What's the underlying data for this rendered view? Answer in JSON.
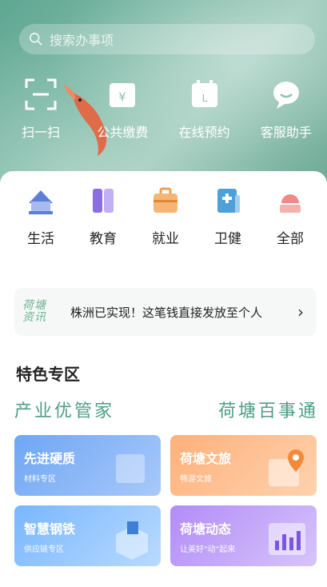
{
  "search": {
    "placeholder": "搜索办事项"
  },
  "quick_actions": [
    {
      "label": "扫一扫",
      "icon": "scan-icon"
    },
    {
      "label": "公共缴费",
      "icon": "payment-icon"
    },
    {
      "label": "在线预约",
      "icon": "calendar-icon"
    },
    {
      "label": "客服助手",
      "icon": "chat-icon"
    }
  ],
  "categories": [
    {
      "label": "生活",
      "icon": "home-icon",
      "color": "#5f7fd6"
    },
    {
      "label": "教育",
      "icon": "book-icon",
      "color": "#8b6fe0"
    },
    {
      "label": "就业",
      "icon": "briefcase-icon",
      "color": "#f2a04e"
    },
    {
      "label": "卫健",
      "icon": "health-icon",
      "color": "#4ea0d8"
    },
    {
      "label": "全部",
      "icon": "all-icon",
      "color": "#f08a86"
    }
  ],
  "news": {
    "tag_line1": "荷塘",
    "tag_line2": "资讯",
    "headline": "株洲已实现！这笔钱直接发放至个人",
    "arrow": "›"
  },
  "featured": {
    "title": "特色专区",
    "tabs": [
      "产业优管家",
      "荷塘百事通"
    ],
    "cards": [
      {
        "title": "先进硬质",
        "subtitle": "材料专区",
        "color": "#6fa6f4"
      },
      {
        "title": "荷塘文旅",
        "subtitle": "畅游文旅",
        "color": "#ffb07a"
      },
      {
        "title": "智慧钢铁",
        "subtitle": "供应链专区",
        "color": "#78b7ff"
      },
      {
        "title": "荷塘动态",
        "subtitle": "让美好\"动\"起来",
        "color": "#b28cf7"
      }
    ]
  }
}
